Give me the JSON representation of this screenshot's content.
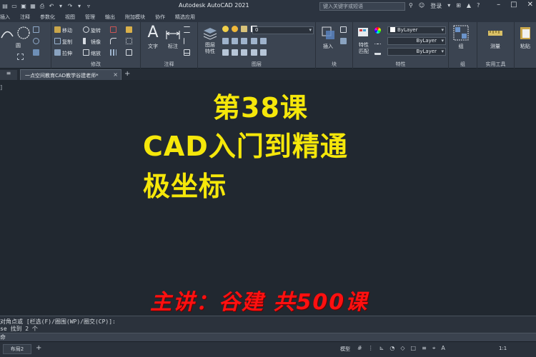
{
  "window": {
    "title": "Autodesk AutoCAD 2021",
    "search_placeholder": "键入关键字或短语",
    "login_label": "登录"
  },
  "menu_tabs": [
    "插入",
    "注释",
    "参数化",
    "视图",
    "管理",
    "输出",
    "附加模块",
    "协作",
    "精选应用"
  ],
  "ribbon": {
    "draw": {
      "items": [
        "圆",
        "圆弧"
      ],
      "title": ""
    },
    "modify": {
      "title": "修改",
      "items": [
        "移动",
        "旋转",
        "复制",
        "镜像",
        "拉伸",
        "缩放"
      ]
    },
    "annotation": {
      "title": "注释",
      "text_label": "文字",
      "dimension_label": "标注"
    },
    "layers": {
      "title": "图层",
      "properties_label": "图层\n特性",
      "layer_value": "0"
    },
    "block": {
      "title": "块",
      "insert_label": "插入"
    },
    "properties": {
      "title": "特性",
      "match_label": "特性\n匹配",
      "color_value": "ByLayer",
      "linetype_value": "ByLayer",
      "lineweight_value": "ByLayer"
    },
    "group": {
      "title": "组",
      "group_label": "组"
    },
    "utilities": {
      "title": "实用工具",
      "measure_label": "测量"
    },
    "clipboard": {
      "paste_label": "粘贴"
    }
  },
  "doc_tabs": {
    "active": "一点空间教育CAD教学谷建老师*"
  },
  "canvas": {
    "bracket": "]",
    "line1": "第38课",
    "line2": "CAD入门到精通",
    "line3": "极坐标",
    "credits": "主讲：谷建    共500课"
  },
  "command": {
    "line1": "对角点或 [栏选(F)/圈围(WP)/圈交(CP)]:",
    "line2": "se 找到 2 个",
    "input": "命"
  },
  "status": {
    "layout_tab": "布局2",
    "model_label": "模型",
    "scale_label": "1:1"
  },
  "colors": {
    "title_text": "#f5e70a",
    "credits_text": "#ff1010",
    "canvas_bg": "#212830"
  }
}
